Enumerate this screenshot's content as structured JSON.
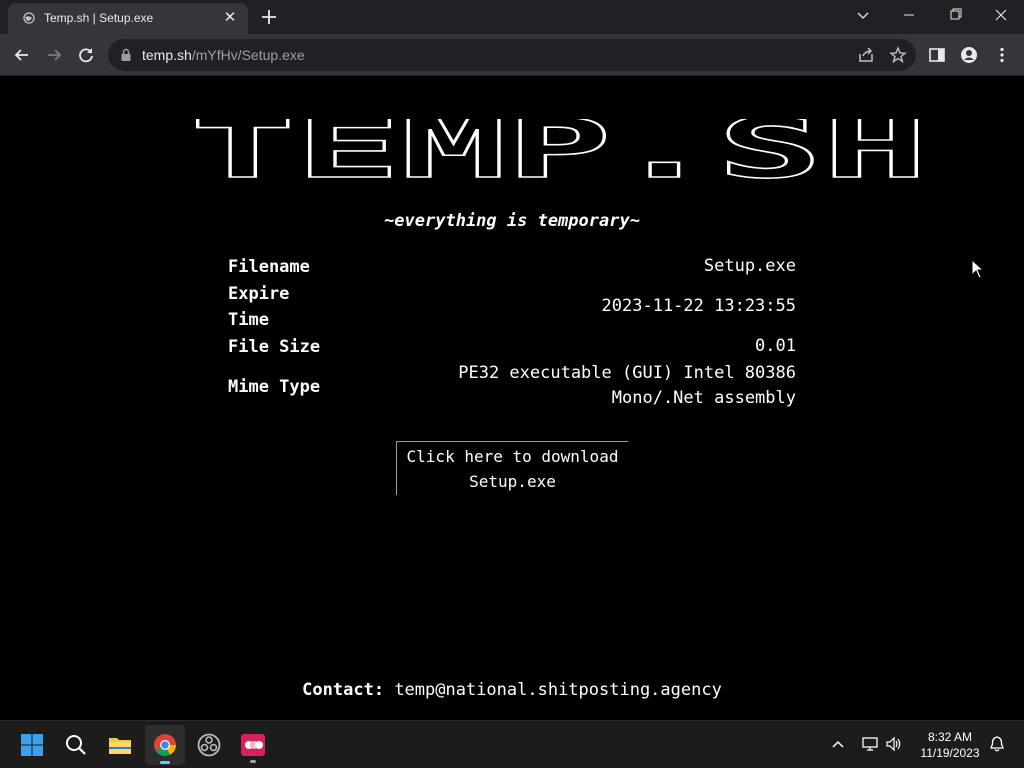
{
  "browser": {
    "tab": {
      "title": "Temp.sh | Setup.exe"
    },
    "address": {
      "host": "temp.sh",
      "path": "/mYfHv/Setup.exe"
    }
  },
  "page": {
    "logo_text": "TEMP.SH",
    "tagline": "~everything is temporary~",
    "file_info": {
      "filename_label": "Filename",
      "filename_value": "Setup.exe",
      "expire_label_line1": "Expire",
      "expire_label_line2": "Time",
      "expire_value": "2023-11-22 13:23:55",
      "size_label": "File Size",
      "size_value": "0.01",
      "mime_label": "Mime Type",
      "mime_value_line1": "PE32 executable (GUI) Intel 80386",
      "mime_value_line2": "Mono/.Net assembly"
    },
    "download": {
      "line1": "Click here to download",
      "line2": "Setup.exe"
    },
    "contact": {
      "label": "Contact:",
      "email": "temp@national.shitposting.agency"
    }
  },
  "taskbar": {
    "time": "8:32 AM",
    "date": "11/19/2023"
  },
  "colors": {
    "page_bg": "#000000",
    "chrome_dark": "#202124",
    "chrome_tab": "#35363a",
    "taskbar_bg": "#1c1c1c",
    "accent": "#60cdff"
  }
}
